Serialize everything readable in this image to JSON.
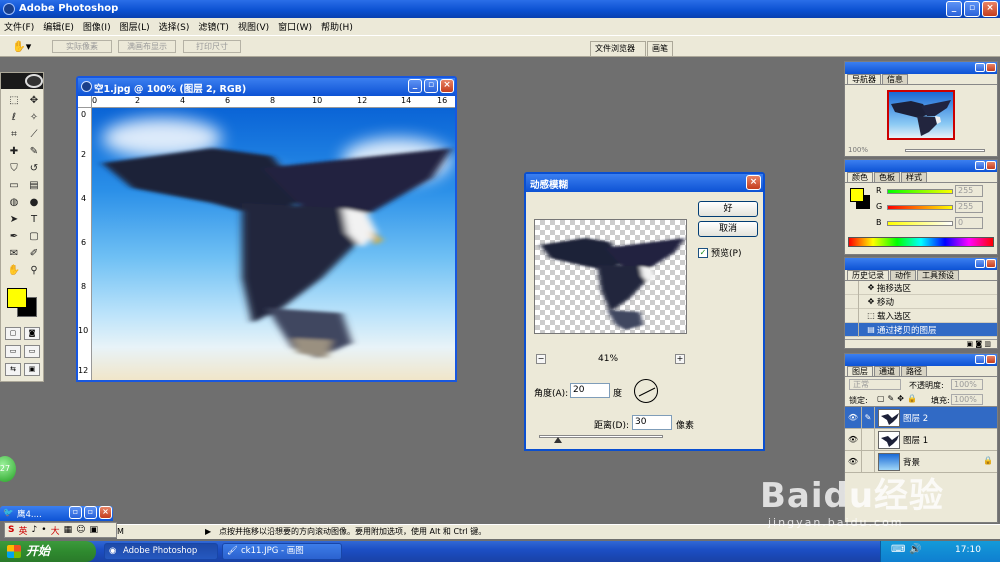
{
  "app": {
    "title": "Adobe Photoshop",
    "window_controls": {
      "minimize": "_",
      "restore": "▫",
      "close": "×"
    }
  },
  "menubar": {
    "items": [
      "文件(F)",
      "编辑(E)",
      "图像(I)",
      "图层(L)",
      "选择(S)",
      "滤镜(T)",
      "视图(V)",
      "窗口(W)",
      "帮助(H)"
    ]
  },
  "options": {
    "buttons": [
      "实际像素",
      "满画布显示",
      "打印尺寸"
    ],
    "wells": [
      "文件浏览器",
      "画笔"
    ]
  },
  "document": {
    "title": "空1.jpg @ 100% (图层 2, RGB)",
    "ruler_top": [
      "0",
      "2",
      "4",
      "6",
      "8",
      "10",
      "12",
      "14",
      "16"
    ],
    "ruler_left": [
      "0",
      "2",
      "4",
      "6",
      "8",
      "10",
      "12"
    ]
  },
  "dialog": {
    "title": "动感模糊",
    "ok_label": "好",
    "cancel_label": "取消",
    "preview_label": "预览(P)",
    "preview_checked": true,
    "zoom": "41%",
    "zoom_minus": "−",
    "zoom_plus": "+",
    "angle_label": "角度(A):",
    "angle_value": "20",
    "angle_unit": "度",
    "distance_label": "距离(D):",
    "distance_value": "30",
    "distance_unit": "像素",
    "distance_slider_fraction": 0.15
  },
  "panels": {
    "navigator": {
      "tabs": [
        "导航器",
        "信息"
      ],
      "zoom": "100%"
    },
    "color": {
      "tabs": [
        "颜色",
        "色板",
        "样式"
      ],
      "channels": [
        {
          "label": "R",
          "value": "255",
          "color": "#ff0000"
        },
        {
          "label": "G",
          "value": "255",
          "color": "#00aa00"
        },
        {
          "label": "B",
          "value": "0",
          "color": "#0000ff"
        }
      ],
      "foreground": "#ffff00",
      "background": "#000000"
    },
    "history": {
      "tabs": [
        "历史记录",
        "动作",
        "工具预设"
      ],
      "items": [
        "拖移选区",
        "移动",
        "载入选区",
        "通过拷贝的图层"
      ],
      "selected_index": 3
    },
    "layers": {
      "tabs": [
        "图层",
        "通道",
        "路径"
      ],
      "blend_mode": "正常",
      "opacity_label": "不透明度:",
      "opacity": "100%",
      "lock_label": "锁定:",
      "fill_label": "填充:",
      "fill": "100%",
      "items": [
        {
          "name": "图层 2",
          "selected": true
        },
        {
          "name": "图层 1",
          "selected": false
        },
        {
          "name": "背景",
          "selected": false
        }
      ]
    }
  },
  "statusbar": {
    "zoom_fragment": "M",
    "hint": "点按并拖移以沿想要的方向滚动图像。要用附加选项，使用 Alt 和 Ctrl 键。"
  },
  "ime": {
    "title": "鹰4....",
    "bar": [
      "英",
      "♪",
      "•",
      "大",
      "▦",
      "☺",
      "▣"
    ]
  },
  "taskbar": {
    "start_label": "开始",
    "tasks": [
      {
        "label": "Adobe Photoshop",
        "active": true
      },
      {
        "label": "ck11.JPG - 画图",
        "active": false
      }
    ],
    "clock": "17:10"
  },
  "watermark": {
    "main": "Baidu经验",
    "sub": "jingyan.baidu.com"
  },
  "ball_label": "27"
}
